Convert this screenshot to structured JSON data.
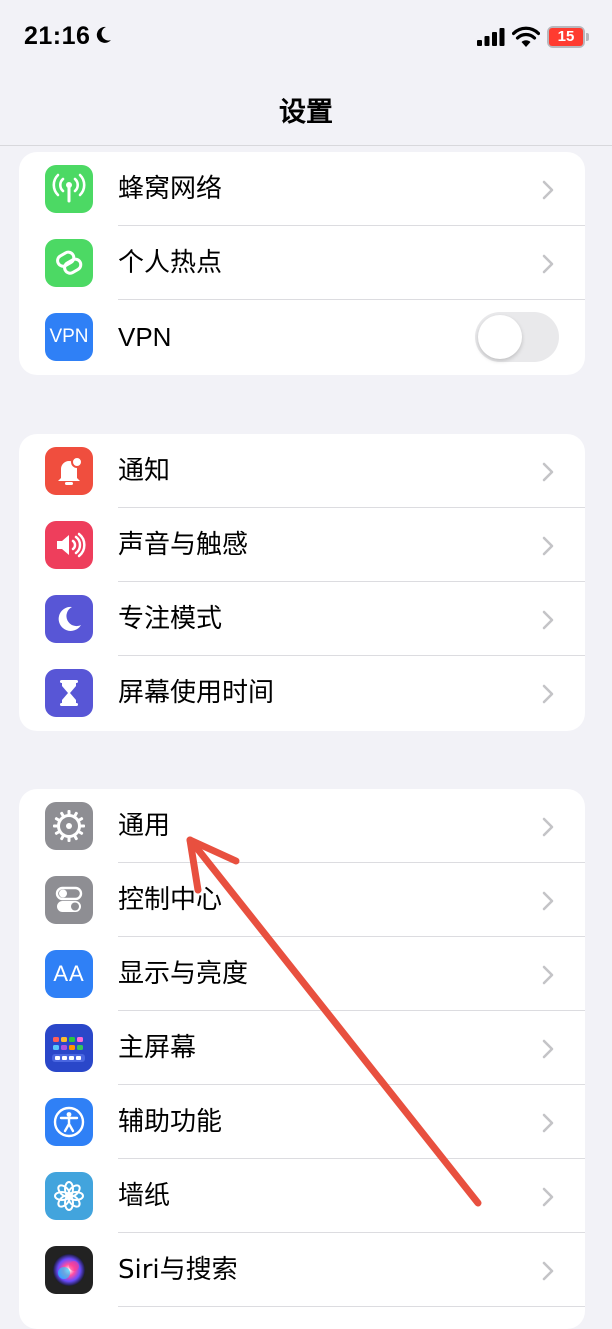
{
  "status_bar": {
    "time": "21:16",
    "battery_level": "15",
    "battery_color": "#ff3b30"
  },
  "nav": {
    "title": "设置"
  },
  "groups": [
    {
      "rows": [
        {
          "label": "蜂窝网络",
          "icon": "cellular-antenna-icon",
          "color": "#4cd964",
          "control": "chevron"
        },
        {
          "label": "个人热点",
          "icon": "hotspot-link-icon",
          "color": "#4cd964",
          "control": "chevron"
        },
        {
          "label": "VPN",
          "icon": "vpn-icon",
          "icon_text": "VPN",
          "color": "#2f80f6",
          "control": "toggle",
          "toggle_on": false
        }
      ]
    },
    {
      "rows": [
        {
          "label": "通知",
          "icon": "notification-bell-icon",
          "color": "#f04e3e",
          "control": "chevron"
        },
        {
          "label": "声音与触感",
          "icon": "speaker-icon",
          "color": "#ee3e5c",
          "control": "chevron"
        },
        {
          "label": "专注模式",
          "icon": "moon-icon",
          "color": "#5856d6",
          "control": "chevron"
        },
        {
          "label": "屏幕使用时间",
          "icon": "hourglass-icon",
          "color": "#5856d6",
          "control": "chevron"
        }
      ]
    },
    {
      "rows": [
        {
          "label": "通用",
          "icon": "gear-icon",
          "color": "#8e8e93",
          "control": "chevron"
        },
        {
          "label": "控制中心",
          "icon": "toggles-icon",
          "color": "#8e8e93",
          "control": "chevron"
        },
        {
          "label": "显示与亮度",
          "icon": "text-size-icon",
          "icon_text": "AA",
          "color": "#2f80f6",
          "control": "chevron"
        },
        {
          "label": "主屏幕",
          "icon": "home-screen-grid-icon",
          "color": "#2a47c9",
          "control": "chevron"
        },
        {
          "label": "辅助功能",
          "icon": "accessibility-icon",
          "color": "#2f80f6",
          "control": "chevron"
        },
        {
          "label": "墙纸",
          "icon": "flower-icon",
          "color": "#42a4dd",
          "control": "chevron"
        },
        {
          "label": "Siri与搜索",
          "icon": "siri-icon",
          "color": "#222222",
          "control": "chevron"
        }
      ]
    }
  ],
  "annotation": {
    "type": "arrow",
    "color": "#e8503f",
    "points_to": "通用"
  }
}
